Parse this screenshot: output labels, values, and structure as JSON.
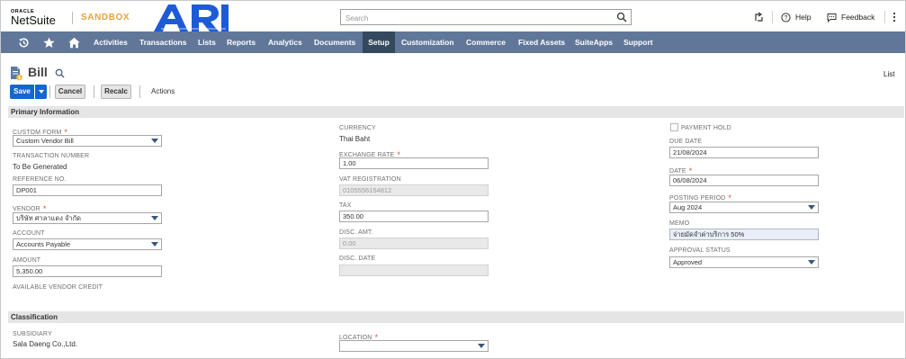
{
  "header": {
    "oracle": "ORACLE",
    "netsuite": "NetSuite",
    "sandbox": "SANDBOX",
    "search_placeholder": "Search",
    "help": "Help",
    "feedback": "Feedback"
  },
  "nav": {
    "items": [
      "Activities",
      "Transactions",
      "Lists",
      "Reports",
      "Analytics",
      "Documents",
      "Setup",
      "Customization",
      "Commerce",
      "Fixed Assets",
      "SuiteApps",
      "Support"
    ],
    "active": "Setup"
  },
  "page": {
    "title": "Bill",
    "list_link": "List",
    "save": "Save",
    "cancel": "Cancel",
    "recalc": "Recalc",
    "actions": "Actions"
  },
  "sections": {
    "primary": "Primary Information",
    "classification": "Classification"
  },
  "fields": {
    "custom_form": {
      "label": "CUSTOM FORM",
      "value": "Custom Vendor Bill"
    },
    "transaction_number": {
      "label": "TRANSACTION NUMBER",
      "value": "To Be Generated"
    },
    "reference_no": {
      "label": "REFERENCE NO.",
      "value": "DP001"
    },
    "vendor": {
      "label": "VENDOR",
      "value": "บริษัท ศาลาแดง จำกัด"
    },
    "account": {
      "label": "ACCOUNT",
      "value": "Accounts Payable"
    },
    "amount": {
      "label": "AMOUNT",
      "value": "5,350.00"
    },
    "available_vendor_credit": {
      "label": "AVAILABLE VENDOR CREDIT"
    },
    "currency": {
      "label": "CURRENCY",
      "value": "Thai Baht"
    },
    "exchange_rate": {
      "label": "EXCHANGE RATE",
      "value": "1.00"
    },
    "vat_registration": {
      "label": "VAT REGISTRATION",
      "value": "0105556154812"
    },
    "tax": {
      "label": "TAX",
      "value": "350.00"
    },
    "disc_amt": {
      "label": "DISC. AMT.",
      "value": "0.00"
    },
    "disc_date": {
      "label": "DISC. DATE",
      "value": ""
    },
    "payment_hold": {
      "label": "PAYMENT HOLD"
    },
    "due_date": {
      "label": "DUE DATE",
      "value": "21/08/2024"
    },
    "date": {
      "label": "DATE",
      "value": "06/08/2024"
    },
    "posting_period": {
      "label": "POSTING PERIOD",
      "value": "Aug 2024"
    },
    "memo": {
      "label": "MEMO",
      "value": "จ่ายมัดจำค่าบริการ 50%"
    },
    "approval_status": {
      "label": "APPROVAL STATUS",
      "value": "Approved"
    },
    "subsidiary": {
      "label": "SUBSIDIARY",
      "value": "Sala Daeng Co.,Ltd."
    },
    "location": {
      "label": "LOCATION",
      "value": ""
    }
  },
  "colors": {
    "nav_bg": "#607799",
    "nav_active": "#34495e",
    "save_button": "#1467cc",
    "sandbox": "#e8a33d",
    "logo": "#1d5bd6",
    "required": "#d6532d"
  }
}
